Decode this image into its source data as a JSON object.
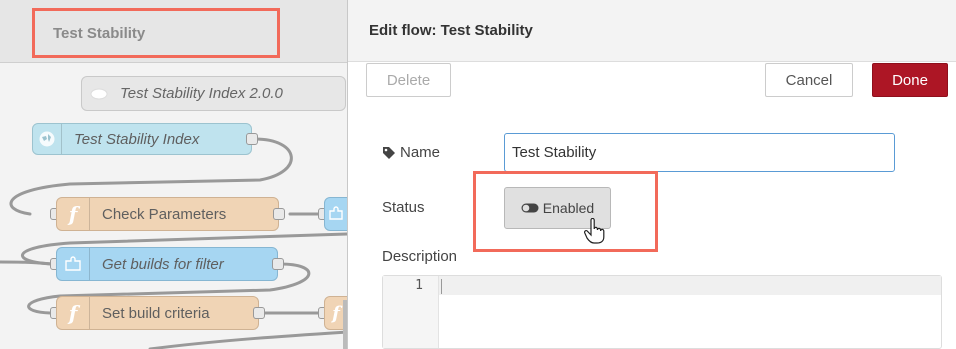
{
  "flow_tab": {
    "label": "Test Stability"
  },
  "nodes": [
    {
      "label": "Test Stability Index 2.0.0",
      "type": "subflow-template",
      "icon": "subflow-icon"
    },
    {
      "label": "Test Stability Index",
      "type": "http-in",
      "icon": "globe-icon"
    },
    {
      "label": "Check Parameters",
      "type": "function",
      "icon": "function-icon"
    },
    {
      "label": "Get builds for filter",
      "type": "subflow",
      "icon": "puzzle-icon"
    },
    {
      "label": "Set build criteria",
      "type": "function",
      "icon": "function-icon"
    }
  ],
  "tray": {
    "title": "Edit flow: Test Stability",
    "delete_label": "Delete",
    "cancel_label": "Cancel",
    "done_label": "Done"
  },
  "form": {
    "name_label": "Name",
    "name_value": "Test Stability",
    "status_label": "Status",
    "status_value": "Enabled",
    "description_label": "Description",
    "editor_line": "1"
  },
  "colors": {
    "highlight": "#f26a5a",
    "done_button": "#ad1625",
    "function_node": "#f0d4b5",
    "http_node": "#bfe3ee",
    "subflow_node": "#a6d6f2",
    "input_focus": "#5a9bd5"
  }
}
